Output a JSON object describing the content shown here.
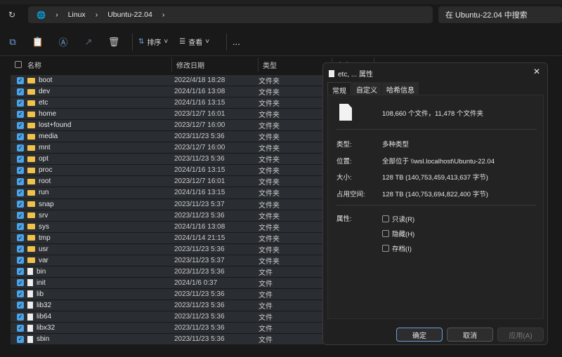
{
  "address": {
    "crumbs": [
      "Linux",
      "Ubuntu-22.04"
    ],
    "search_placeholder": "在 Ubuntu-22.04 中搜索"
  },
  "toolbar": {
    "sort": "排序",
    "view": "查看",
    "more": "..."
  },
  "columns": {
    "name": "名称",
    "date": "修改日期",
    "type": "类型",
    "size": "大小"
  },
  "rows": [
    {
      "name": "boot",
      "date": "2022/4/18 18:28",
      "type": "文件夹",
      "kind": "folder"
    },
    {
      "name": "dev",
      "date": "2024/1/16 13:08",
      "type": "文件夹",
      "kind": "folder"
    },
    {
      "name": "etc",
      "date": "2024/1/16 13:15",
      "type": "文件夹",
      "kind": "folder"
    },
    {
      "name": "home",
      "date": "2023/12/7 16:01",
      "type": "文件夹",
      "kind": "folder"
    },
    {
      "name": "lost+found",
      "date": "2023/12/7 16:00",
      "type": "文件夹",
      "kind": "folder"
    },
    {
      "name": "media",
      "date": "2023/11/23 5:36",
      "type": "文件夹",
      "kind": "folder"
    },
    {
      "name": "mnt",
      "date": "2023/12/7 16:00",
      "type": "文件夹",
      "kind": "folder"
    },
    {
      "name": "opt",
      "date": "2023/11/23 5:36",
      "type": "文件夹",
      "kind": "folder"
    },
    {
      "name": "proc",
      "date": "2024/1/16 13:15",
      "type": "文件夹",
      "kind": "folder"
    },
    {
      "name": "root",
      "date": "2023/12/7 16:01",
      "type": "文件夹",
      "kind": "folder"
    },
    {
      "name": "run",
      "date": "2024/1/16 13:15",
      "type": "文件夹",
      "kind": "folder"
    },
    {
      "name": "snap",
      "date": "2023/11/23 5:37",
      "type": "文件夹",
      "kind": "folder"
    },
    {
      "name": "srv",
      "date": "2023/11/23 5:36",
      "type": "文件夹",
      "kind": "folder"
    },
    {
      "name": "sys",
      "date": "2024/1/16 13:08",
      "type": "文件夹",
      "kind": "folder"
    },
    {
      "name": "tmp",
      "date": "2024/1/14 21:15",
      "type": "文件夹",
      "kind": "folder"
    },
    {
      "name": "usr",
      "date": "2023/11/23 5:36",
      "type": "文件夹",
      "kind": "folder"
    },
    {
      "name": "var",
      "date": "2023/11/23 5:37",
      "type": "文件夹",
      "kind": "folder"
    },
    {
      "name": "bin",
      "date": "2023/11/23 5:36",
      "type": "文件",
      "kind": "file"
    },
    {
      "name": "init",
      "date": "2024/1/6 0:37",
      "type": "文件",
      "kind": "file"
    },
    {
      "name": "lib",
      "date": "2023/11/23 5:36",
      "type": "文件",
      "kind": "file"
    },
    {
      "name": "lib32",
      "date": "2023/11/23 5:36",
      "type": "文件",
      "kind": "file"
    },
    {
      "name": "lib64",
      "date": "2023/11/23 5:36",
      "type": "文件",
      "kind": "file"
    },
    {
      "name": "libx32",
      "date": "2023/11/23 5:36",
      "type": "文件",
      "kind": "file"
    },
    {
      "name": "sbin",
      "date": "2023/11/23 5:36",
      "type": "文件",
      "kind": "file"
    }
  ],
  "dialog": {
    "title": "etc, ... 属性",
    "tabs": [
      "常规",
      "自定义",
      "哈希信息"
    ],
    "summary": "108,660 个文件，11,478 个文件夹",
    "type_label": "类型:",
    "type_value": "多种类型",
    "location_label": "位置:",
    "location_value": "全部位于 \\\\wsl.localhost\\Ubuntu-22.04",
    "size_label": "大小:",
    "size_value": "128 TB (140,753,459,413,637 字节)",
    "disk_label": "占用空间:",
    "disk_value": "128 TB (140,753,694,822,400 字节)",
    "attr_label": "属性:",
    "attrs": [
      "只读(R)",
      "隐藏(H)",
      "存档(I)"
    ],
    "ok": "确定",
    "cancel": "取消",
    "apply": "应用(A)"
  }
}
